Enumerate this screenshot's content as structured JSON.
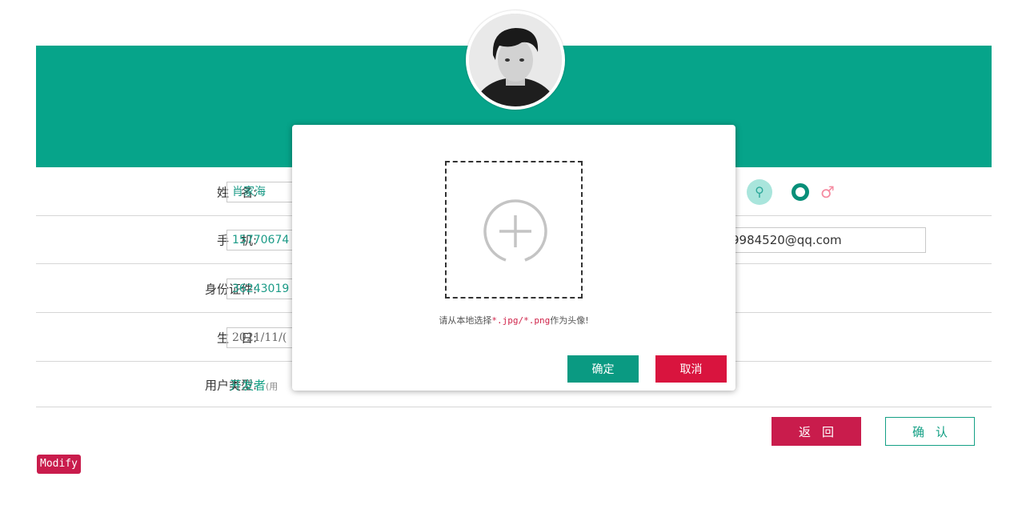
{
  "profile": {
    "name_label": "姓　名:",
    "name_value": "肖家海",
    "phone_label": "手　机:",
    "phone_value": "15770674",
    "email_value": "9984520@qq.com",
    "id_label": "身份证件:",
    "id_value": "36243019",
    "birthday_label": "生　日:",
    "birthday_value": "2021/11/(",
    "usertype_label": "用户类型:",
    "usertype_value": "开发者",
    "usertype_note": "(用",
    "gender_female_icon": "female-symbol-icon",
    "gender_male_icon": "male-symbol-icon",
    "gender_male_glyph": "♂",
    "gender_female_glyph": "⚲"
  },
  "actions": {
    "back_label": "返回",
    "confirm_label": "确认"
  },
  "badge": {
    "modify_label": "Modify"
  },
  "modal": {
    "hint_prefix": "请从本地选择",
    "hint_types": "*.jpg/*.png",
    "hint_suffix": "作为头像!",
    "confirm_label": "确定",
    "cancel_label": "取消"
  },
  "colors": {
    "primary": "#06a48a",
    "danger": "#c91c4c",
    "modal_cancel": "#d9143e"
  }
}
